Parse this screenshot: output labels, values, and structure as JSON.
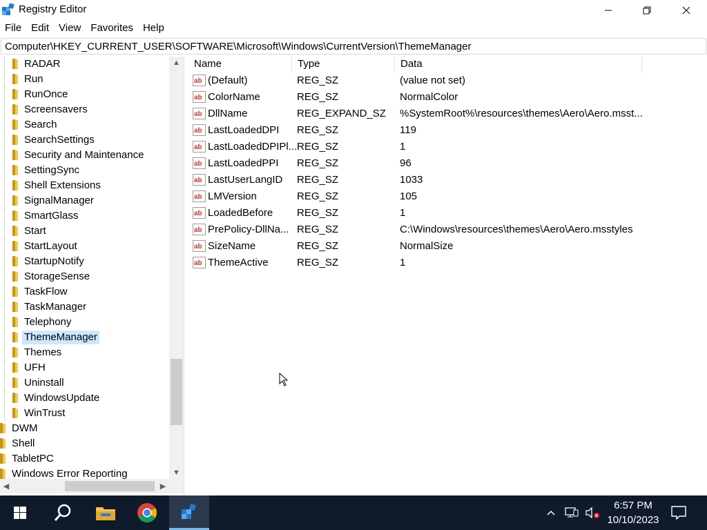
{
  "window": {
    "title": "Registry Editor"
  },
  "menu": [
    "File",
    "Edit",
    "View",
    "Favorites",
    "Help"
  ],
  "address": "Computer\\HKEY_CURRENT_USER\\SOFTWARE\\Microsoft\\Windows\\CurrentVersion\\ThemeManager",
  "tree": {
    "items": [
      {
        "label": "RADAR",
        "level": 2
      },
      {
        "label": "Run",
        "level": 2
      },
      {
        "label": "RunOnce",
        "level": 2
      },
      {
        "label": "Screensavers",
        "level": 2
      },
      {
        "label": "Search",
        "level": 2
      },
      {
        "label": "SearchSettings",
        "level": 2
      },
      {
        "label": "Security and Maintenance",
        "level": 2
      },
      {
        "label": "SettingSync",
        "level": 2
      },
      {
        "label": "Shell Extensions",
        "level": 2
      },
      {
        "label": "SignalManager",
        "level": 2
      },
      {
        "label": "SmartGlass",
        "level": 2
      },
      {
        "label": "Start",
        "level": 2
      },
      {
        "label": "StartLayout",
        "level": 2
      },
      {
        "label": "StartupNotify",
        "level": 2
      },
      {
        "label": "StorageSense",
        "level": 2
      },
      {
        "label": "TaskFlow",
        "level": 2
      },
      {
        "label": "TaskManager",
        "level": 2
      },
      {
        "label": "Telephony",
        "level": 2
      },
      {
        "label": "ThemeManager",
        "level": 2,
        "selected": true
      },
      {
        "label": "Themes",
        "level": 2
      },
      {
        "label": "UFH",
        "level": 2
      },
      {
        "label": "Uninstall",
        "level": 2
      },
      {
        "label": "WindowsUpdate",
        "level": 2
      },
      {
        "label": "WinTrust",
        "level": 2
      },
      {
        "label": "DWM",
        "level": 1
      },
      {
        "label": "Shell",
        "level": 1
      },
      {
        "label": "TabletPC",
        "level": 1
      },
      {
        "label": "Windows Error Reporting",
        "level": 1
      }
    ]
  },
  "values": {
    "columns": [
      "Name",
      "Type",
      "Data"
    ],
    "rows": [
      {
        "name": "(Default)",
        "type": "REG_SZ",
        "data": "(value not set)"
      },
      {
        "name": "ColorName",
        "type": "REG_SZ",
        "data": "NormalColor"
      },
      {
        "name": "DllName",
        "type": "REG_EXPAND_SZ",
        "data": "%SystemRoot%\\resources\\themes\\Aero\\Aero.msst..."
      },
      {
        "name": "LastLoadedDPI",
        "type": "REG_SZ",
        "data": "119"
      },
      {
        "name": "LastLoadedDPIPl...",
        "type": "REG_SZ",
        "data": "1"
      },
      {
        "name": "LastLoadedPPI",
        "type": "REG_SZ",
        "data": "96"
      },
      {
        "name": "LastUserLangID",
        "type": "REG_SZ",
        "data": "1033"
      },
      {
        "name": "LMVersion",
        "type": "REG_SZ",
        "data": "105"
      },
      {
        "name": "LoadedBefore",
        "type": "REG_SZ",
        "data": "1"
      },
      {
        "name": "PrePolicy-DllNa...",
        "type": "REG_SZ",
        "data": "C:\\Windows\\resources\\themes\\Aero\\Aero.msstyles"
      },
      {
        "name": "SizeName",
        "type": "REG_SZ",
        "data": "NormalSize"
      },
      {
        "name": "ThemeActive",
        "type": "REG_SZ",
        "data": "1"
      }
    ]
  },
  "taskbar": {
    "time": "6:57 PM",
    "date": "10/10/2023"
  },
  "colors": {
    "selection": "#cce8ff",
    "taskbar": "#0f1a2a",
    "folder": "#e8b84a"
  }
}
